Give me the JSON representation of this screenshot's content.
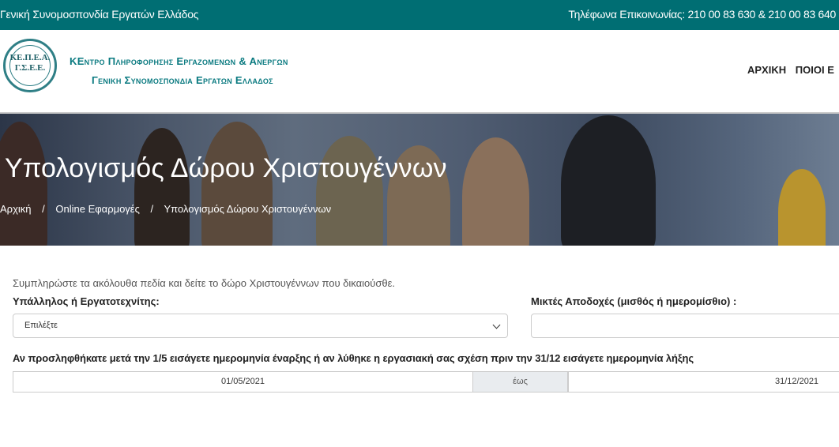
{
  "topbar": {
    "org_name": "Γενική Συνομοσπονδία Εργατών Ελλάδος",
    "phones": "Τηλέφωνα Επικοινωνίας: 210 00 83 630 & 210 00 83 640"
  },
  "header": {
    "logo_line1": "ΚΕ.Π.Ε.Α.",
    "logo_line2": "Γ.Σ.Ε.Ε.",
    "org_line1": "ΚΕντρο Πληροφορησης Εργαζομενων & Ανεργων",
    "org_line2": "Γενικη Συνομοσπονδια Εργατων Ελλαδος",
    "nav": [
      "ΑΡΧΙΚΗ",
      "ΠΟΙΟΙ Ε"
    ]
  },
  "hero": {
    "title": "Υπολογισμός Δώρου Χριστουγέννων",
    "breadcrumb": [
      "Αρχική",
      "Online Εφαρμογές",
      "Υπολογισμός Δώρου Χριστουγέννων"
    ],
    "separator": "/"
  },
  "form": {
    "intro": "Συμπληρώστε τα ακόλουθα πεδία και δείτε το δώρο Χριστουγέννων που δικαιούσθε.",
    "employee_type_label": "Υπάλληλος ή Εργατοτεχνίτης:",
    "employee_type_value": "Επιλέξτε",
    "salary_label": "Μικτές Αποδοχές (μισθός ή ημερομίσθιο) :",
    "salary_value": "",
    "period_label": "Αν προσληφθήκατε μετά την 1/5 εισάγετε ημερομηνία έναρξης ή αν λύθηκε η εργασιακή σας σχέση πριν την 31/12 εισάγετε ημερομηνία λήξης",
    "start_date": "01/05/2021",
    "between_label": "έως",
    "end_date": "31/12/2021"
  }
}
